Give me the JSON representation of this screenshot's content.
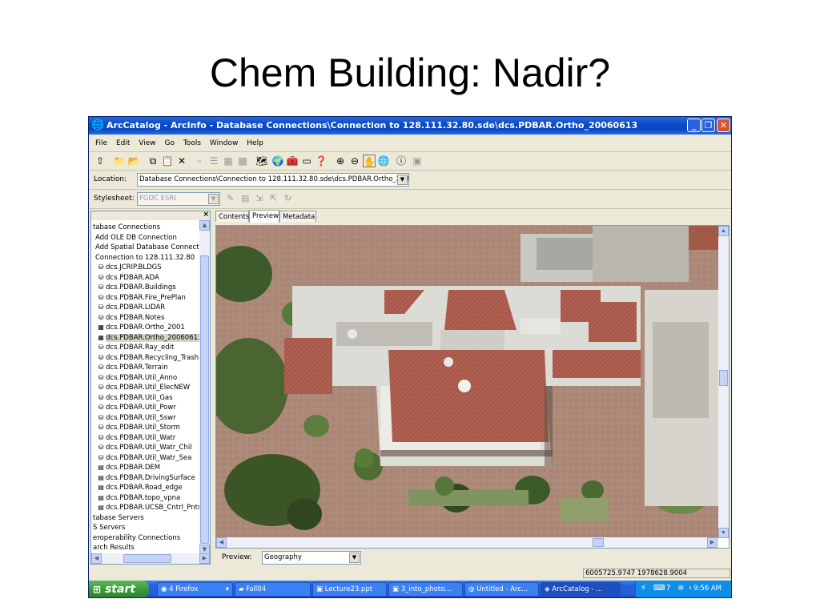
{
  "slide": {
    "title": "Chem Building: Nadir?"
  },
  "window": {
    "title": "ArcCatalog - ArcInfo - Database Connections\\Connection to 128.111.32.80.sde\\dcs.PDBAR.Ortho_20060613",
    "app_icon": "globe-icon",
    "menu": [
      "File",
      "Edit",
      "View",
      "Go",
      "Tools",
      "Window",
      "Help"
    ],
    "location": {
      "label": "Location:",
      "value": "Database Connections\\Connection to 128.111.32.80.sde\\dcs.PDBAR.Ortho_2006061"
    },
    "stylesheet": {
      "label": "Stylesheet:",
      "value": "FGDC ESRI"
    },
    "tree": {
      "close": "×",
      "items": [
        {
          "label": "tabase Connections",
          "icon": ""
        },
        {
          "label": "Add OLE DB Connection",
          "icon": ""
        },
        {
          "label": "Add Spatial Database Connection",
          "icon": ""
        },
        {
          "label": "Connection to 128.111.32.80",
          "icon": ""
        },
        {
          "label": "dcs.JCRIP.BLDGS",
          "icon": "feature-class"
        },
        {
          "label": "dcs.PDBAR.ADA",
          "icon": "feature-class"
        },
        {
          "label": "dcs.PDBAR.Buildings",
          "icon": "feature-class"
        },
        {
          "label": "dcs.PDBAR.Fire_PrePlan",
          "icon": "feature-class"
        },
        {
          "label": "dcs.PDBAR.LIDAR",
          "icon": "feature-class"
        },
        {
          "label": "dcs.PDBAR.Notes",
          "icon": "feature-class"
        },
        {
          "label": "dcs.PDBAR.Ortho_2001",
          "icon": "raster"
        },
        {
          "label": "dcs.PDBAR.Ortho_20060613",
          "icon": "raster",
          "selected": true
        },
        {
          "label": "dcs.PDBAR.Ray_edit",
          "icon": "feature-class"
        },
        {
          "label": "dcs.PDBAR.Recycling_Trash",
          "icon": "feature-class"
        },
        {
          "label": "dcs.PDBAR.Terrain",
          "icon": "feature-class"
        },
        {
          "label": "dcs.PDBAR.Util_Anno",
          "icon": "feature-class"
        },
        {
          "label": "dcs.PDBAR.Util_ElecNEW",
          "icon": "feature-class"
        },
        {
          "label": "dcs.PDBAR.Util_Gas",
          "icon": "feature-class"
        },
        {
          "label": "dcs.PDBAR.Util_Powr",
          "icon": "feature-class"
        },
        {
          "label": "dcs.PDBAR.Util_Sswr",
          "icon": "feature-class"
        },
        {
          "label": "dcs.PDBAR.Util_Storm",
          "icon": "feature-class"
        },
        {
          "label": "dcs.PDBAR.Util_Watr",
          "icon": "feature-class"
        },
        {
          "label": "dcs.PDBAR.Util_Watr_Chil",
          "icon": "feature-class"
        },
        {
          "label": "dcs.PDBAR.Util_Watr_Sea",
          "icon": "feature-class"
        },
        {
          "label": "dcs.PDBAR.DEM",
          "icon": "table"
        },
        {
          "label": "dcs.PDBAR.DrivingSurface",
          "icon": "table"
        },
        {
          "label": "dcs.PDBAR.Road_edge",
          "icon": "table"
        },
        {
          "label": "dcs.PDBAR.topo_vpna",
          "icon": "table"
        },
        {
          "label": "dcs.PDBAR.UCSB_Cntrl_Pnts",
          "icon": "table"
        },
        {
          "label": "tabase Servers",
          "icon": ""
        },
        {
          "label": "S Servers",
          "icon": ""
        },
        {
          "label": "eroperability Connections",
          "icon": ""
        },
        {
          "label": "arch Results",
          "icon": ""
        }
      ]
    },
    "tabs": [
      {
        "label": "Contents",
        "active": false
      },
      {
        "label": "Preview",
        "active": true
      },
      {
        "label": "Metadata",
        "active": false
      }
    ],
    "preview": {
      "label": "Preview:",
      "value": "Geography",
      "image_description": "aerial orthophoto of chemistry building rooftop"
    },
    "status": {
      "coords": "6005725.9747  1978628.9004"
    }
  },
  "taskbar": {
    "start_label": "start",
    "items": [
      {
        "label": "4 Firefox",
        "icon": "firefox-icon"
      },
      {
        "label": "Fall04",
        "icon": "folder-icon"
      },
      {
        "label": "Lecture23.ppt",
        "icon": "ppt-icon"
      },
      {
        "label": "3_into_photo...",
        "icon": "ppt-icon"
      },
      {
        "label": "Untitled - Arc...",
        "icon": "globe-icon"
      },
      {
        "label": "ArcCatalog - ...",
        "icon": "arccatalog-icon",
        "active": true
      }
    ],
    "clock": "9:56 AM"
  }
}
